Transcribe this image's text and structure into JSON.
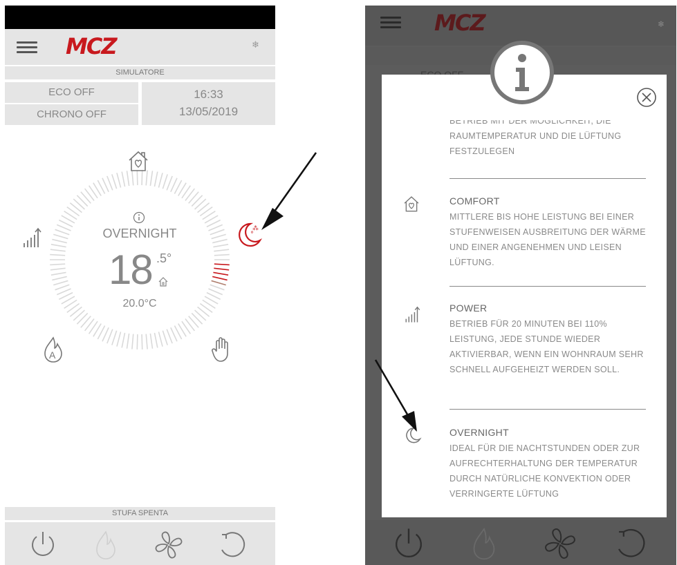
{
  "left": {
    "brand": "MCZ",
    "mode_label": "SIMULATORE",
    "eco": "ECO OFF",
    "chrono": "CHRONO OFF",
    "time": "16:33",
    "date": "13/05/2019",
    "active_mode": "OVERNIGHT",
    "temp_int": "18",
    "temp_dec": ".5°",
    "setpoint": "20.0°C",
    "status": "STUFA SPENTA"
  },
  "right": {
    "brand": "MCZ",
    "bg_eco": "ECO OFF",
    "sections": [
      {
        "title": "",
        "body": "BETRIEB MIT DER MÖGLICHKEIT, DIE RAUMTEMPERATUR UND DIE LÜFTUNG FESTZULEGEN"
      },
      {
        "title": "COMFORT",
        "body": "MITTLERE BIS HOHE LEISTUNG BEI EINER STUFENWEISEN AUSBREITUNG DER WÄRME UND EINER ANGENEHMEN UND LEISEN LÜFTUNG."
      },
      {
        "title": "POWER",
        "body": "BETRIEB FÜR 20 MINUTEN BEI 110% LEISTUNG, JEDE STUNDE WIEDER AKTIVIERBAR, WENN EIN WOHNRAUM SEHR SCHNELL AUFGEHEIZT WERDEN SOLL."
      },
      {
        "title": "OVERNIGHT",
        "body": "IDEAL FÜR DIE NACHTSTUNDEN ODER ZUR AUFRECHTERHALTUNG DER TEMPERATUR DURCH NATÜRLICHE KONVEKTION ODER VERRINGERTE LÜFTUNG"
      }
    ]
  },
  "colors": {
    "accent": "#c8191e",
    "bar": "#e5e5e5",
    "overlay": "#5c5c5c"
  }
}
